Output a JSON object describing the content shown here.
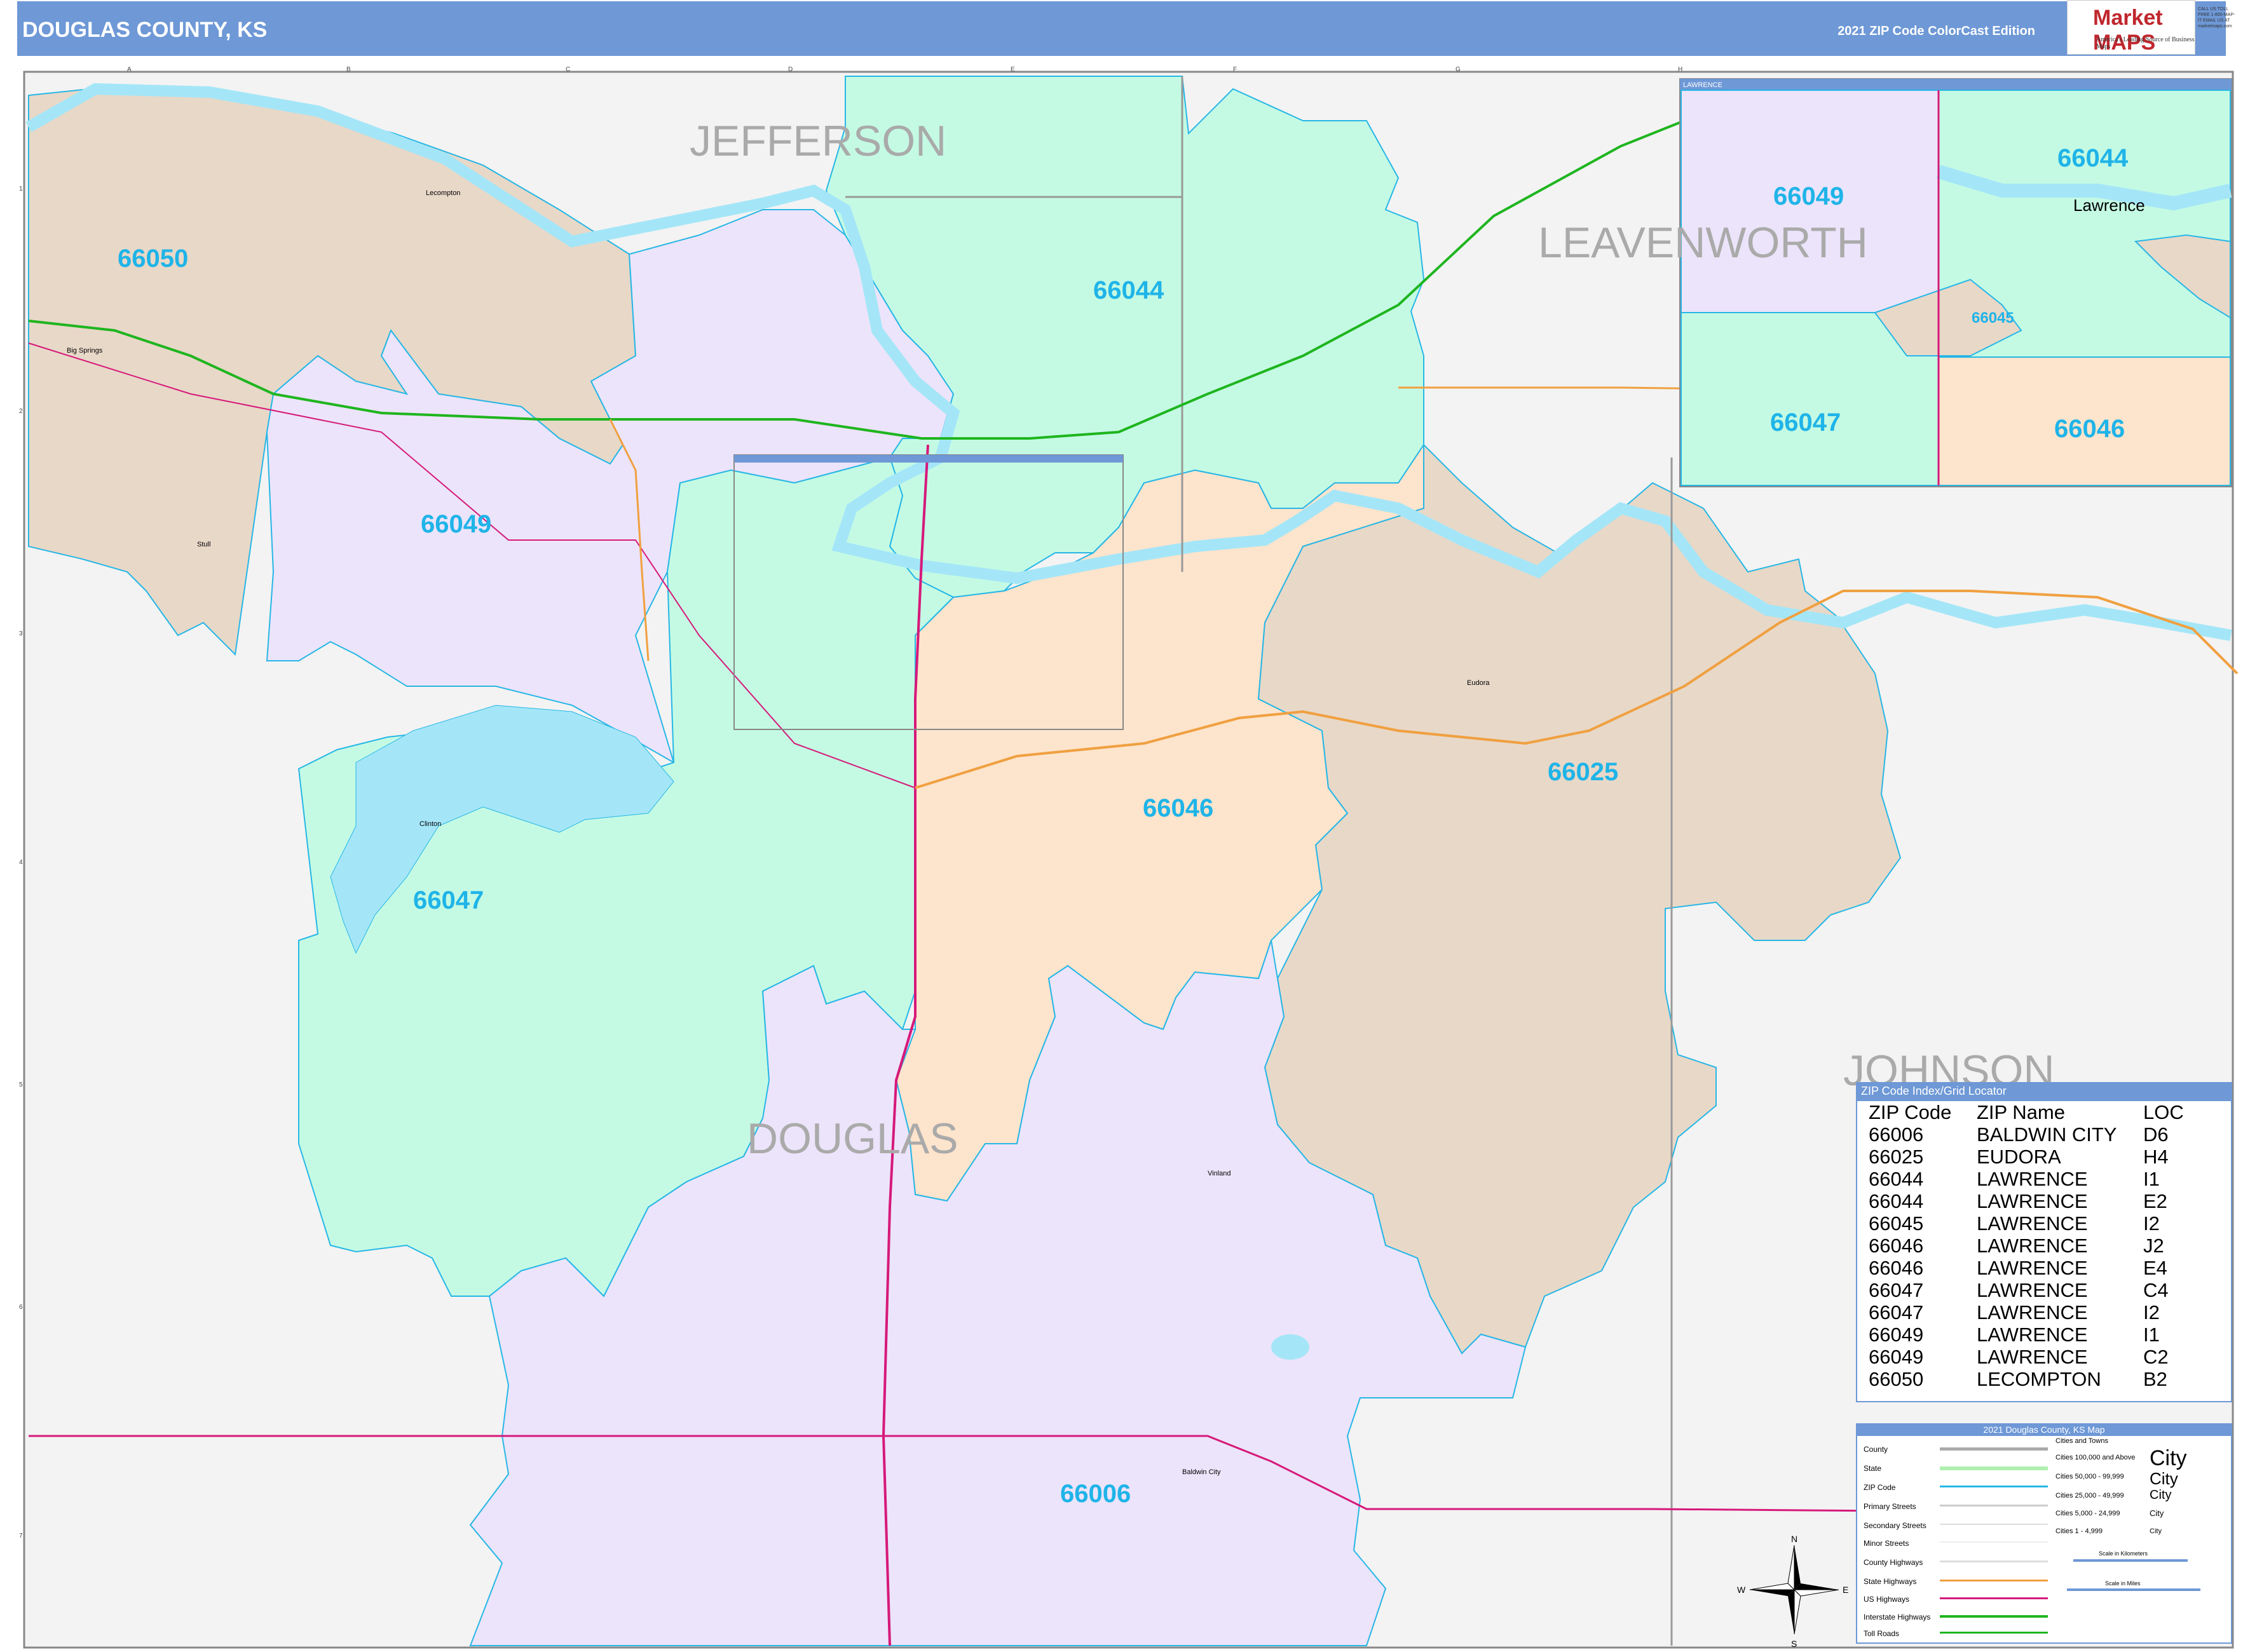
{
  "header": {
    "title": "DOUGLAS COUNTY, KS",
    "edition": "2021 ZIP Code ColorCast Edition",
    "logo_name": "Market MAPS",
    "logo_tagline": "America's Leading Source of Business Maps",
    "logo_contact": "CALL US TOLL FREE 1-800-MAP-IT EMAIL US AT marketmaps.com"
  },
  "grid": {
    "columns": [
      "A",
      "B",
      "C",
      "D",
      "E",
      "F",
      "G",
      "H",
      "I",
      "J"
    ],
    "rows": [
      "1",
      "2",
      "3",
      "4",
      "5",
      "6",
      "7"
    ]
  },
  "county_labels": [
    "JEFFERSON",
    "LEAVENWORTH",
    "JOHNSON",
    "DOUGLAS"
  ],
  "zip_labels": [
    "66050",
    "66044",
    "66049",
    "66047",
    "66046",
    "66025",
    "66006"
  ],
  "towns": [
    "Lecompton",
    "Big Springs",
    "Stull",
    "Clinton",
    "Eudora",
    "Vinland",
    "Baldwin City"
  ],
  "inset": {
    "title": "LAWRENCE",
    "city_label": "Lawrence",
    "zips": [
      "66049",
      "66044",
      "66045",
      "66047",
      "66046"
    ]
  },
  "zip_index": {
    "title": "ZIP Code Index/Grid Locator",
    "headers": [
      "ZIP Code",
      "ZIP Name",
      "LOC"
    ],
    "rows": [
      [
        "66006",
        "BALDWIN CITY",
        "D6"
      ],
      [
        "66025",
        "EUDORA",
        "H4"
      ],
      [
        "66044",
        "LAWRENCE",
        "I1"
      ],
      [
        "66044",
        "LAWRENCE",
        "E2"
      ],
      [
        "66045",
        "LAWRENCE",
        "I2"
      ],
      [
        "66046",
        "LAWRENCE",
        "J2"
      ],
      [
        "66046",
        "LAWRENCE",
        "E4"
      ],
      [
        "66047",
        "LAWRENCE",
        "C4"
      ],
      [
        "66047",
        "LAWRENCE",
        "I2"
      ],
      [
        "66049",
        "LAWRENCE",
        "I1"
      ],
      [
        "66049",
        "LAWRENCE",
        "C2"
      ],
      [
        "66050",
        "LECOMPTON",
        "B2"
      ]
    ]
  },
  "legend": {
    "title": "2021 Douglas County, KS Map",
    "items": [
      "County",
      "State",
      "ZIP Code",
      "Primary Streets",
      "Secondary Streets",
      "Minor Streets",
      "County Highways",
      "State Highways",
      "US Highways",
      "Interstate Highways",
      "Toll Roads"
    ],
    "cities_title": "Cities and Towns",
    "cities": [
      [
        "Cities 100,000 and Above",
        "City"
      ],
      [
        "Cities 50,000 - 99,999",
        "City"
      ],
      [
        "Cities 25,000 - 49,999",
        "City"
      ],
      [
        "Cities 5,000 - 24,999",
        "City"
      ],
      [
        "Cities 1 - 4,999",
        "City"
      ]
    ],
    "scale_km": "Scale in Kilometers",
    "scale_mi": "Scale in Miles"
  },
  "compass": {
    "n": "N",
    "s": "S",
    "e": "E",
    "w": "W"
  },
  "colors": {
    "header": "#6e98d6",
    "water": "#a4e6f8",
    "zip_border": "#27b7e6",
    "zip_label": "#1fb4e8",
    "zip_66050": "#e8d8c8",
    "zip_66025": "#e8d8c8",
    "zip_66049": "#ece4fa",
    "zip_66006": "#ece4fa",
    "zip_66044": "#c4fae4",
    "zip_66047": "#c4fae4",
    "zip_66046": "#fde4cc",
    "outside": "#f3f3f3",
    "interstate": "#1fb51f",
    "us_highway": "#d6197a",
    "state_highway": "#f0a040"
  }
}
